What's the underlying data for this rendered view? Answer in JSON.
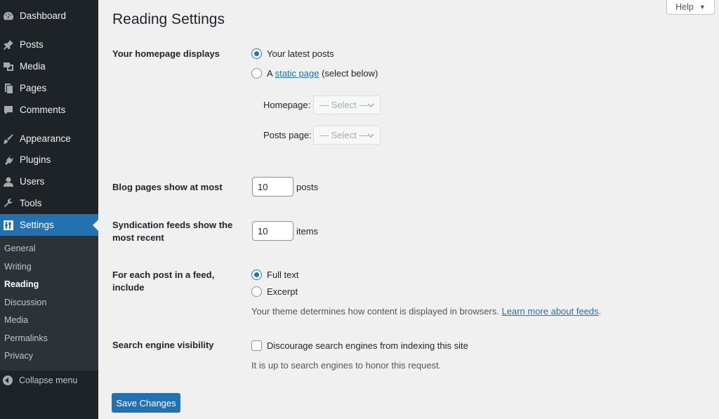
{
  "sidebar": {
    "items": [
      {
        "label": "Dashboard",
        "icon": "dashboard-icon"
      },
      {
        "label": "Posts",
        "icon": "pin-icon"
      },
      {
        "label": "Media",
        "icon": "media-icon"
      },
      {
        "label": "Pages",
        "icon": "pages-icon"
      },
      {
        "label": "Comments",
        "icon": "comment-icon"
      },
      {
        "label": "Appearance",
        "icon": "brush-icon"
      },
      {
        "label": "Plugins",
        "icon": "plug-icon"
      },
      {
        "label": "Users",
        "icon": "user-icon"
      },
      {
        "label": "Tools",
        "icon": "wrench-icon"
      },
      {
        "label": "Settings",
        "icon": "settings-icon",
        "current": true
      }
    ],
    "submenu": [
      "General",
      "Writing",
      "Reading",
      "Discussion",
      "Media",
      "Permalinks",
      "Privacy"
    ],
    "submenu_current": "Reading",
    "collapse_label": "Collapse menu"
  },
  "help": {
    "label": "Help",
    "arrow": "▼"
  },
  "page": {
    "title": "Reading Settings",
    "homepage_displays": {
      "label": "Your homepage displays",
      "option_latest": "Your latest posts",
      "option_static_prefix": "A",
      "option_static_link": "static page",
      "option_static_suffix": "(select below)",
      "selected": "latest",
      "homepage_label": "Homepage:",
      "homepage_value": "— Select —",
      "posts_page_label": "Posts page:",
      "posts_page_value": "— Select —"
    },
    "blog_pages": {
      "label": "Blog pages show at most",
      "value": "10",
      "unit": "posts"
    },
    "syndication": {
      "label_line1": "Syndication feeds show the",
      "label_line2": "most recent",
      "value": "10",
      "unit": "items"
    },
    "feed_include": {
      "label_line1": "For each post in a feed,",
      "label_line2": "include",
      "option_full": "Full text",
      "option_excerpt": "Excerpt",
      "selected": "full",
      "note": "Your theme determines how content is displayed in browsers.",
      "note_link": "Learn more about feeds",
      "note_end": "."
    },
    "search_visibility": {
      "label": "Search engine visibility",
      "checkbox_label": "Discourage search engines from indexing this site",
      "checked": false,
      "note": "It is up to search engines to honor this request."
    },
    "save_label": "Save Changes"
  },
  "colors": {
    "sidebar_bg": "#1d2327",
    "submenu_bg": "#2c3338",
    "accent": "#2271b1",
    "page_bg": "#f0f0f1"
  }
}
